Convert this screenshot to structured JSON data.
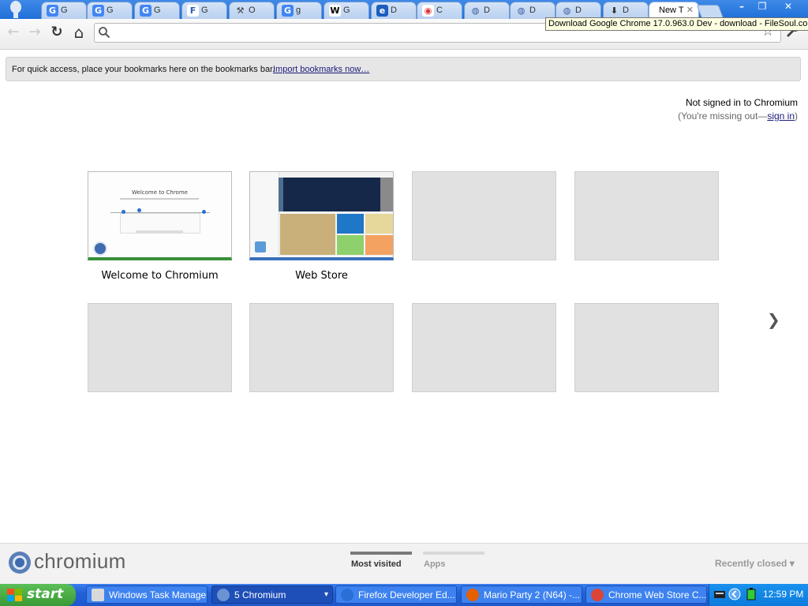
{
  "window": {
    "tabs": [
      {
        "icon": "google-icon",
        "title": "G"
      },
      {
        "icon": "google-icon",
        "title": "G"
      },
      {
        "icon": "google-icon",
        "title": "G"
      },
      {
        "icon": "filesoul-icon",
        "title": "G"
      },
      {
        "icon": "wrench-icon",
        "title": "O"
      },
      {
        "icon": "google-icon",
        "title": "g"
      },
      {
        "icon": "wikipedia-icon",
        "title": "G"
      },
      {
        "icon": "chrome-logo-icon",
        "title": "D"
      },
      {
        "icon": "chrome-icon",
        "title": "C"
      },
      {
        "icon": "globe-icon",
        "title": "D"
      },
      {
        "icon": "globe-icon",
        "title": "D"
      },
      {
        "icon": "globe-icon",
        "title": "D"
      },
      {
        "icon": "download-icon",
        "title": "D"
      },
      {
        "icon": "none",
        "title": "New T",
        "active": true
      }
    ],
    "controls": {
      "minimize": "–",
      "maximize": "❐",
      "close": "✕"
    }
  },
  "toolbar": {
    "back": "←",
    "forward": "→",
    "reload": "↻",
    "home": "⌂",
    "omnibox_value": "",
    "star": "☆",
    "wrench": "🔧"
  },
  "tooltip": "Download Google Chrome 17.0.963.0 Dev - download - FileSoul.com",
  "bookmark_bar": {
    "text": "For quick access, place your bookmarks here on the bookmarks bar.",
    "link": "Import bookmarks now…"
  },
  "sign_in": {
    "status": "Not signed in to Chromium",
    "prefix": "(You're missing out—",
    "link": "sign in",
    "suffix": ")"
  },
  "most_visited": [
    {
      "label": "Welcome to Chromium",
      "filled": true,
      "preview_title": "Welcome to Chrome",
      "accent": "#3a8f3a"
    },
    {
      "label": "Web Store",
      "filled": true,
      "accent": "#3a6fbf"
    },
    {
      "label": "",
      "filled": false
    },
    {
      "label": "",
      "filled": false
    },
    {
      "label": "",
      "filled": false
    },
    {
      "label": "",
      "filled": false
    },
    {
      "label": "",
      "filled": false
    },
    {
      "label": "",
      "filled": false
    }
  ],
  "next_arrow": "❯",
  "footer": {
    "logo": "chromium",
    "tabs": [
      {
        "label": "Most visited",
        "selected": true
      },
      {
        "label": "Apps",
        "selected": false
      }
    ],
    "recently_closed": "Recently closed ▾"
  },
  "taskbar": {
    "start": "start",
    "tasks": [
      {
        "icon": "task-manager-icon",
        "label": "Windows Task Manager",
        "active": false
      },
      {
        "icon": "chromium-icon",
        "label": "5 Chromium",
        "active": true
      },
      {
        "icon": "firefox-dev-icon",
        "label": "Firefox Developer Ed...",
        "active": false
      },
      {
        "icon": "firefox-icon",
        "label": "Mario Party 2 (N64) -...",
        "active": false
      },
      {
        "icon": "chrome-icon",
        "label": "Chrome Web Store C...",
        "active": false
      }
    ],
    "clock": "12:59 PM"
  },
  "colors": {
    "titlebar": "#1f6fd8",
    "taskbar": "#2460d8",
    "start": "#3a9a35",
    "link": "#1a1a7a"
  }
}
